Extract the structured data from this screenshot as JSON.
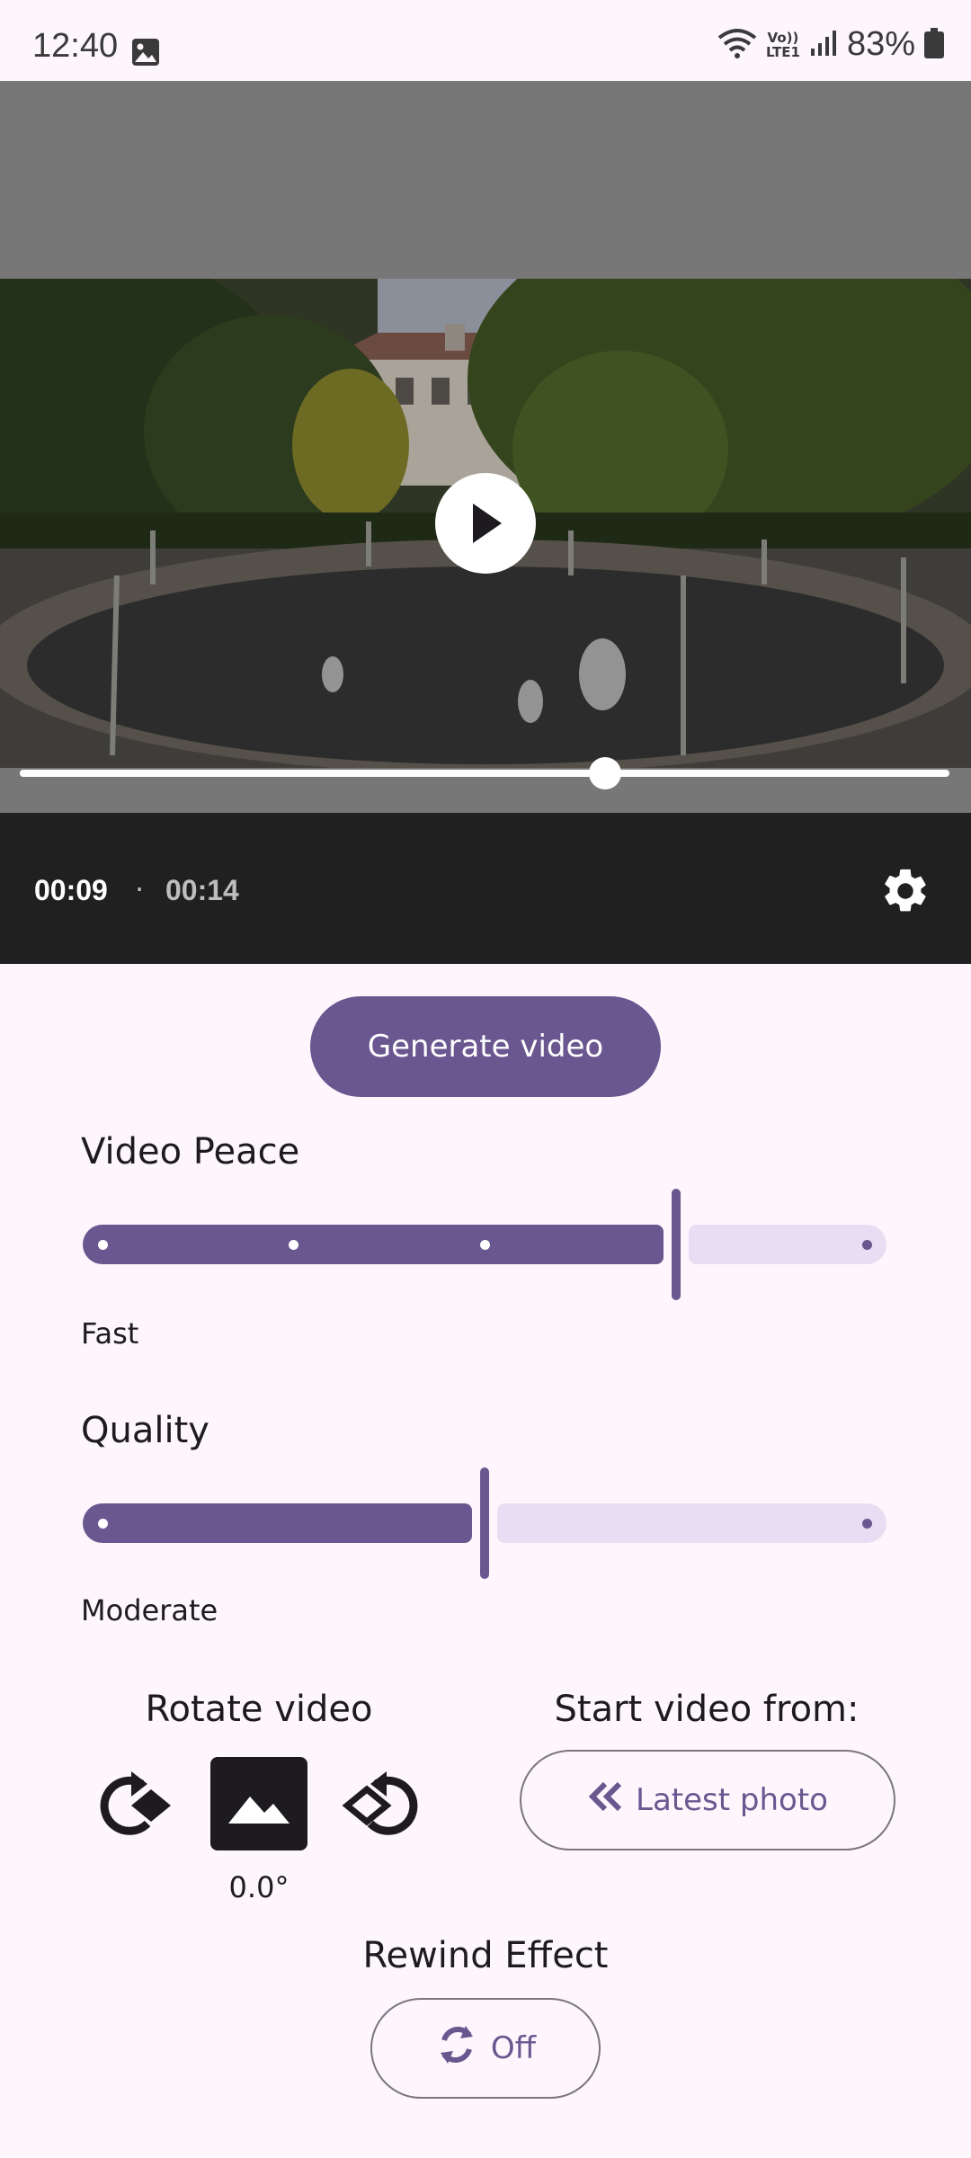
{
  "status_bar": {
    "time": "12:40",
    "network_label_top": "Vo))",
    "network_label_bottom": "LTE1",
    "battery": "83%"
  },
  "player": {
    "current_time": "00:09",
    "separator": "·",
    "duration": "00:14",
    "progress_fraction": 0.63
  },
  "generate_button": {
    "label": "Generate video"
  },
  "video_pace": {
    "title": "Video Peace",
    "value_label": "Fast",
    "position_fraction": 0.75,
    "steps": 4
  },
  "quality": {
    "title": "Quality",
    "value_label": "Moderate",
    "position_fraction": 0.5,
    "steps": 2
  },
  "rotate": {
    "title": "Rotate video",
    "angle": "0.0°"
  },
  "start_from": {
    "title": "Start video from:",
    "button_label": "Latest photo"
  },
  "rewind": {
    "title": "Rewind Effect",
    "button_label": "Off"
  },
  "colors": {
    "accent": "#6a5790",
    "accent_light": "#e9ddf3",
    "background": "#fdf7fd",
    "control_bar": "#202020"
  }
}
